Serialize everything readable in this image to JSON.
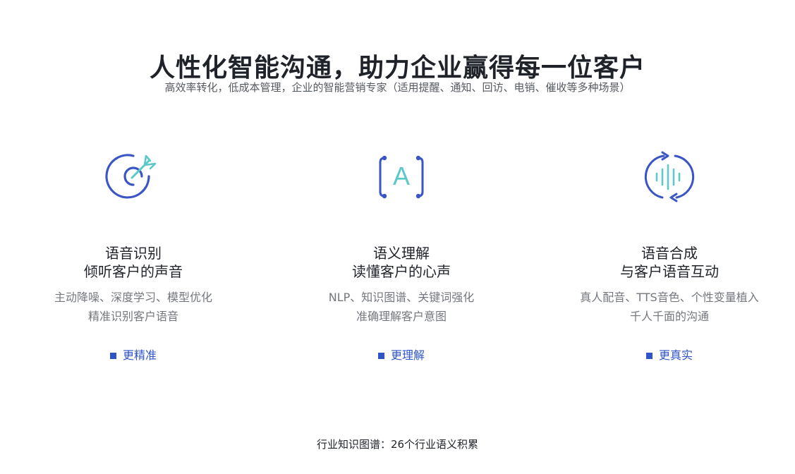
{
  "header": {
    "title": "人性化智能沟通，助力企业赢得每一位客户",
    "subtitle": "高效率转化，低成本管理，企业的智能营销专家（适用提醒、通知、回访、电销、催收等多种场景）"
  },
  "features": [
    {
      "icon": "target-arrow-icon",
      "title_line1": "语音识别",
      "title_line2": "倾听客户的声音",
      "desc_line1": "主动降噪、深度学习、模型优化",
      "desc_line2": "精准识别客户语音",
      "tag": "更精准"
    },
    {
      "icon": "letter-a-brackets-icon",
      "icon_letter": "A",
      "title_line1": "语义理解",
      "title_line2": "读懂客户的心声",
      "desc_line1": "NLP、知识图谱、关键词强化",
      "desc_line2": "准确理解客户意图",
      "tag": "更理解"
    },
    {
      "icon": "voice-wave-sync-icon",
      "title_line1": "语音合成",
      "title_line2": "与客户语音互动",
      "desc_line1": "真人配音、TTS音色、个性变量植入",
      "desc_line2": "千人千面的沟通",
      "tag": "更真实"
    }
  ],
  "footer": {
    "text": "行业知识图谱：26个行业语义积累"
  },
  "colors": {
    "accent_blue": "#2f54c8",
    "accent_teal": "#5cc8c8",
    "title": "#1f2329",
    "desc": "#74787e"
  }
}
